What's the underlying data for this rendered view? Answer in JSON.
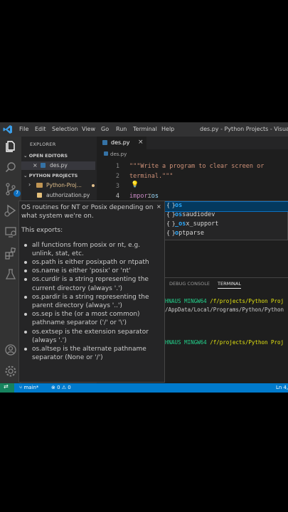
{
  "titlebar": {
    "menu": [
      "File",
      "Edit",
      "Selection",
      "View",
      "Go",
      "Run",
      "Terminal",
      "Help"
    ],
    "window_title": "des.py - Python Projects - Visual Studio Code"
  },
  "activity_badge": "7",
  "explorer": {
    "title": "EXPLORER",
    "open_editors_label": "OPEN EDITORS",
    "open_file": "des.py",
    "project_label": "PYTHON PROJECTS",
    "folder": "Python-Proj...",
    "file": "authorization.py"
  },
  "editor": {
    "tab": "des.py",
    "breadcrumb": "des.py",
    "line_numbers": [
      "1",
      "2",
      "3",
      "4"
    ],
    "line1": "\"\"\"Write a program to clear screen or",
    "line2": "terminal.\"\"\"",
    "line4_kw": "impor",
    "line4_mod": "os"
  },
  "suggestions": [
    {
      "icon": "{ }",
      "match": "os",
      "rest": ""
    },
    {
      "icon": "{ }",
      "match": "os",
      "rest": "saudiodev"
    },
    {
      "icon": "{ }",
      "match": "_os",
      "rest": "x_support"
    },
    {
      "icon": "{ }",
      "match": "o",
      "rest": "ptparse"
    }
  ],
  "docs": {
    "intro": "OS routines for NT or Posix depending on what system we're on.",
    "exports": "This exports:",
    "items": [
      "all functions from posix or nt, e.g. unlink, stat, etc.",
      "os.path is either posixpath or ntpath",
      "os.name is either 'posix' or 'nt'",
      "os.curdir is a string representing the current directory (always '.')",
      "os.pardir is a string representing the parent directory (always '..')",
      "os.sep is the (or a most common) pathname separator ('/' or '\\')",
      "os.extsep is the extension separator (always '.')",
      "os.altsep is the alternate pathname separator (None or '/')"
    ],
    "close": "×"
  },
  "panel": {
    "debug_tab": "DEBUG CONSOLE",
    "terminal_tab": "TERMINAL",
    "line1_host": "HNAUS MINGW64",
    "line1_path": "/f/projects/Python Proj",
    "line2": "/AppData/Local/Programs/Python/Python",
    "line3_host": "HNAUS MINGW64",
    "line3_path": "/f/projects/Python Proj"
  },
  "statusbar": {
    "branch": "main*",
    "problems": "⊗ 0 ⚠ 0",
    "position": "Ln 4,"
  },
  "colors": {
    "accent": "#007acc",
    "string": "#ce9178",
    "keyword": "#c586c0",
    "highlight": "#2aaaff",
    "terminal_green": "#23d18b",
    "terminal_yellow": "#e5e510"
  }
}
